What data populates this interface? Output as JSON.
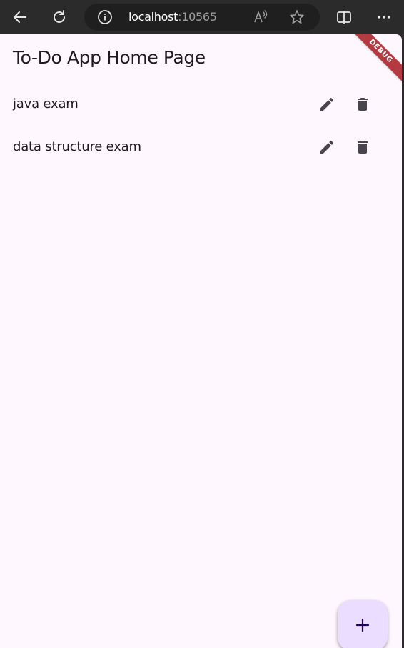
{
  "browser": {
    "host": "localhost",
    "port": ":10565"
  },
  "app": {
    "title": "To-Do App Home Page",
    "debug_label": "DEBUG"
  },
  "todos": [
    {
      "text": "java exam"
    },
    {
      "text": "data structure exam"
    }
  ],
  "icons": {
    "back": "arrow-left-icon",
    "refresh": "refresh-icon",
    "info": "info-icon",
    "read_aloud": "read-aloud-icon",
    "favorite": "star-icon",
    "split_screen": "split-screen-icon",
    "more": "more-icon",
    "edit": "pencil-icon",
    "delete": "trash-icon",
    "add": "plus-icon"
  },
  "colors": {
    "browser_chrome": "#2b2b2b",
    "address_bar": "#1f1f1f",
    "page_background": "#fef7fe",
    "text": "#1d1b20",
    "icon": "#49454f",
    "fab_background": "#eaddff",
    "fab_icon": "#21005d",
    "debug_banner": "#b23a40"
  }
}
